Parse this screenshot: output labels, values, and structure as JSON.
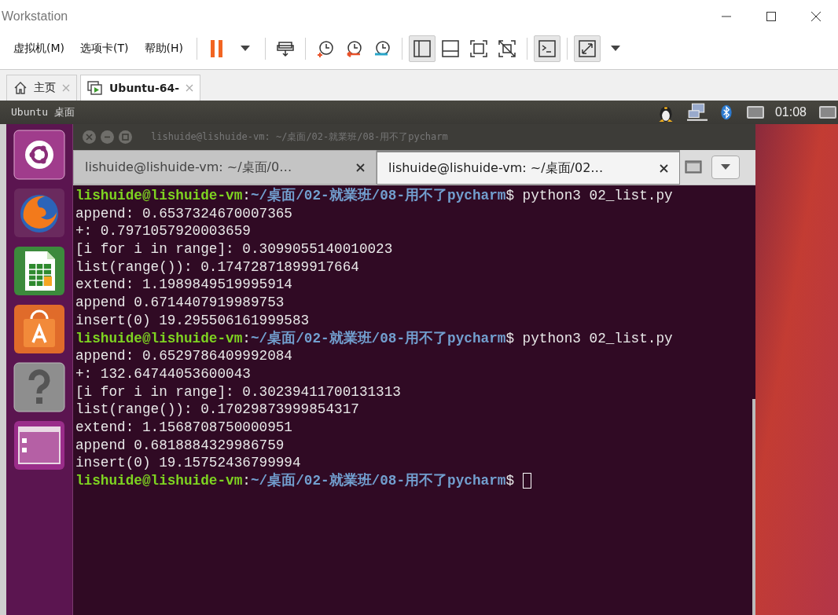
{
  "window": {
    "title": "Workstation"
  },
  "menu": [
    "虚拟机(M)",
    "选项卡(T)",
    "帮助(H)"
  ],
  "toolbar": {
    "view_selected": true,
    "console_selected": true,
    "fullscreen_selected": true
  },
  "tabs": [
    {
      "label": "主页",
      "kind": "home",
      "selected": false
    },
    {
      "label": "Ubuntu-64-",
      "kind": "vm",
      "selected": true
    }
  ],
  "ubuntu_panel": {
    "label": "Ubuntu 桌面",
    "time": "01:08"
  },
  "terminal": {
    "title": "lishuide@lishuide-vm: ~/桌面/02-就業班/08-用不了pycharm",
    "tabs": [
      {
        "label": "lishuide@lishuide-vm: ~/桌面/0…",
        "selected": false
      },
      {
        "label": "lishuide@lishuide-vm: ~/桌面/02…",
        "selected": true
      }
    ],
    "lines": [
      {
        "kind": "prompt",
        "user": "lishuide@lishuide-vm",
        "sep": ":",
        "path": "~/桌面/02-就業班/08-用不了pycharm",
        "command": "$ python3 02_list.py"
      },
      {
        "kind": "output",
        "text": "append: 0.6537324670007365"
      },
      {
        "kind": "output",
        "text": "+: 0.7971057920003659"
      },
      {
        "kind": "output",
        "text": "[i for i in range]: 0.3099055140010023"
      },
      {
        "kind": "output",
        "text": "list(range()): 0.17472871899917664"
      },
      {
        "kind": "output",
        "text": "extend: 1.1989849519995914"
      },
      {
        "kind": "output",
        "text": "append 0.6714407919989753"
      },
      {
        "kind": "output",
        "text": "insert(0) 19.295506161999583"
      },
      {
        "kind": "prompt",
        "user": "lishuide@lishuide-vm",
        "sep": ":",
        "path": "~/桌面/02-就業班/08-用不了pycharm",
        "command": "$ python3 02_list.py"
      },
      {
        "kind": "output",
        "text": "append: 0.6529786409992084"
      },
      {
        "kind": "output",
        "text": "+: 132.64744053600043"
      },
      {
        "kind": "output",
        "text": "[i for i in range]: 0.30239411700131313"
      },
      {
        "kind": "output",
        "text": "list(range()): 0.17029873999854317"
      },
      {
        "kind": "output",
        "text": "extend: 1.1568708750000951"
      },
      {
        "kind": "output",
        "text": "append 0.6818884329986759"
      },
      {
        "kind": "output",
        "text": "insert(0) 19.15752436799994"
      },
      {
        "kind": "prompt",
        "user": "lishuide@lishuide-vm",
        "sep": ":",
        "path": "~/桌面/02-就業班/08-用不了pycharm",
        "command": "$ ",
        "cursor": true
      }
    ]
  }
}
